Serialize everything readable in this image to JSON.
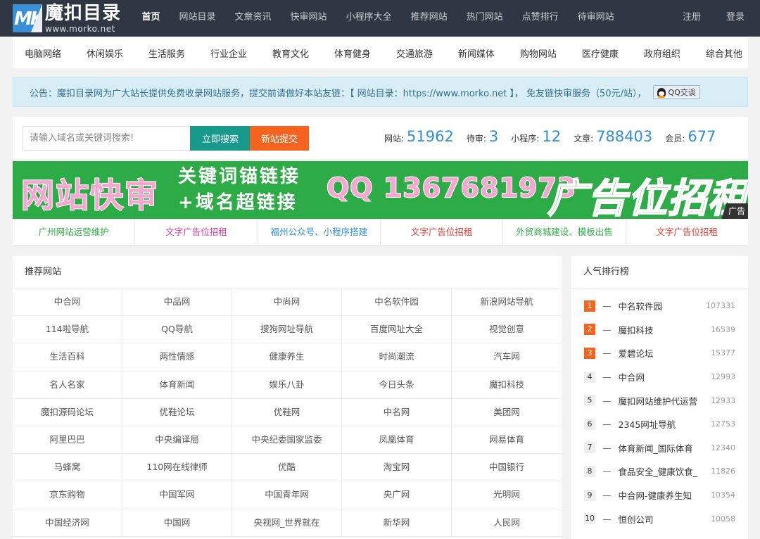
{
  "brand": {
    "name": "魔扣目录",
    "url": "www.morko.net"
  },
  "topnav": [
    "首页",
    "网站目录",
    "文章资讯",
    "快审网站",
    "小程序大全",
    "推荐网站",
    "热门网站",
    "点赞排行",
    "待审网站"
  ],
  "account": {
    "register": "注册",
    "login": "登录"
  },
  "categories": [
    "电脑网络",
    "休闲娱乐",
    "生活服务",
    "行业企业",
    "教育文化",
    "体育健身",
    "交通旅游",
    "新闻媒体",
    "购物网站",
    "医疗健康",
    "政府组织",
    "综合其他"
  ],
  "notice": {
    "text": "公告：魔扣目录网为广大站长提供免费收录网站服务，提交前请做好本站友链：【 网站目录：https://www.morko.net 】， 免友链快审服务（50元/站），",
    "qq_button": "QQ交谈"
  },
  "search": {
    "placeholder": "请输入域名或关键词搜索!",
    "search_button": "立即搜索",
    "submit_button": "新站提交"
  },
  "stats": [
    {
      "label": "网站:",
      "value": "51962"
    },
    {
      "label": "待审:",
      "value": "3"
    },
    {
      "label": "小程序:",
      "value": "12"
    },
    {
      "label": "文章:",
      "value": "788403"
    },
    {
      "label": "会员:",
      "value": "677"
    }
  ],
  "banner": {
    "left": "网站快审",
    "mid_line1": "关键词锚链接",
    "mid_line2": "+域名超链接",
    "qq": "QQ 1367681973",
    "right": "广告位招租",
    "tag": "广告"
  },
  "text_ads": [
    {
      "text": "广州网站运营维护",
      "color": "#2dab46"
    },
    {
      "text": "文字广告位招租",
      "color": "#e0369f"
    },
    {
      "text": "福州公众号、小程序搭建",
      "color": "#2f8fd9"
    },
    {
      "text": "文字广告位招租",
      "color": "#e53935"
    },
    {
      "text": "外贸商城建设、模板出售",
      "color": "#2dab46"
    },
    {
      "text": "文字广告位招租",
      "color": "#e53935"
    }
  ],
  "recommended": {
    "title": "推荐网站",
    "sites": [
      "中合网",
      "中品网",
      "中尚网",
      "中名软件园",
      "新浪网站导航",
      "114啦导航",
      "QQ导航",
      "搜狗网址导航",
      "百度网址大全",
      "视觉创意",
      "生活百科",
      "两性情感",
      "健康养生",
      "时尚潮流",
      "汽车网",
      "名人名家",
      "体育新闻",
      "娱乐八卦",
      "今日头条",
      "魔扣科技",
      "魔扣源码论坛",
      "优鞋论坛",
      "优鞋网",
      "中名网",
      "美团网",
      "阿里巴巴",
      "中央编译局",
      "中央纪委国家监委",
      "凤凰体育",
      "网易体育",
      "马蜂窝",
      "110网在线律师",
      "优酷",
      "淘宝网",
      "中国银行",
      "京东购物",
      "中国军网",
      "中国青年网",
      "央广网",
      "光明网",
      "中国经济网",
      "中国网",
      "央视网_世界就在",
      "新华网",
      "人民网"
    ]
  },
  "ranking": {
    "title": "人气排行榜",
    "items": [
      {
        "rank": "1",
        "name": "中名软件园",
        "count": "107331"
      },
      {
        "rank": "2",
        "name": "魔扣科技",
        "count": "16539"
      },
      {
        "rank": "3",
        "name": "爱碧论坛",
        "count": "15377"
      },
      {
        "rank": "4",
        "name": "中合网",
        "count": "12993"
      },
      {
        "rank": "5",
        "name": "魔扣网站维护代运营",
        "count": "12933"
      },
      {
        "rank": "6",
        "name": "2345网址导航",
        "count": "12753"
      },
      {
        "rank": "7",
        "name": "体育新闻_国际体育",
        "count": "12340"
      },
      {
        "rank": "8",
        "name": "食品安全_健康饮食_",
        "count": "11826"
      },
      {
        "rank": "9",
        "name": "中合网-健康养生知",
        "count": "10354"
      },
      {
        "rank": "10",
        "name": "恒创公司",
        "count": "10058"
      }
    ]
  }
}
